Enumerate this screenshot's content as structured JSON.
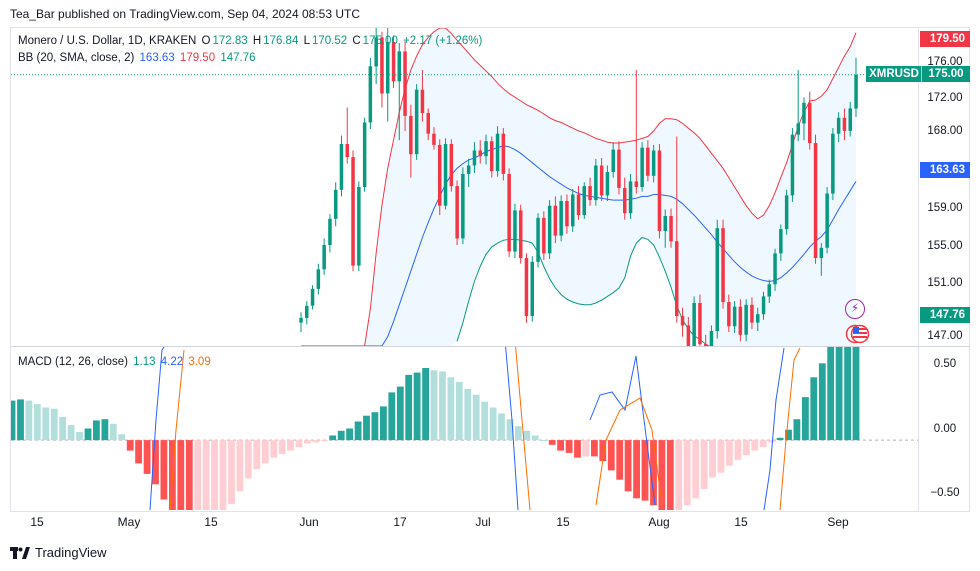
{
  "header": {
    "published": "Tea_Bar published on TradingView.com, Sep 04, 2024 08:53 UTC"
  },
  "legend": {
    "symbol": "Monero / U.S. Dollar, 1D, KRAKEN",
    "o_label": "O",
    "o": "172.83",
    "h_label": "H",
    "h": "176.84",
    "l_label": "L",
    "l": "170.52",
    "c_label": "C",
    "c": "175.00",
    "change": "+2.17 (+1.26%)",
    "bb_label": "BB (20, SMA, close, 2)",
    "bb_basis": "163.63",
    "bb_upper": "179.50",
    "bb_lower": "147.76",
    "macd_label": "MACD (12, 26, close)",
    "macd_hist": "1.13",
    "macd_line": "4.22",
    "macd_signal": "3.09"
  },
  "tags": {
    "upper": "179.50",
    "symbol": "XMRUSD",
    "price": "175.00",
    "basis": "163.63",
    "lower": "147.76"
  },
  "price_axis": [
    "176.00",
    "172.00",
    "168.00",
    "163.63",
    "159.00",
    "155.00",
    "151.00",
    "147.00"
  ],
  "macd_axis": [
    "0.50",
    "0.00",
    "−0.50"
  ],
  "time_axis": [
    "15",
    "May",
    "15",
    "Jun",
    "17",
    "Jul",
    "15",
    "Aug",
    "15",
    "Sep"
  ],
  "footer": {
    "brand": "TradingView"
  },
  "colors": {
    "up": "#089981",
    "down": "#f23645",
    "basis": "#2962ff",
    "upper": "#f23645",
    "lower": "#089981",
    "hist_up_strong": "#26a69a",
    "hist_up_weak": "#b2dfdb",
    "hist_down_strong": "#ff5252",
    "hist_down_weak": "#ffcdd2"
  },
  "chart_data": {
    "type": "candlestick",
    "symbol": "XMRUSD",
    "interval": "1D",
    "price_range_visible": [
      146,
      180
    ],
    "last_close": 175.0,
    "bollinger": {
      "length": 20,
      "basis": 163.63,
      "upper": 179.5,
      "lower": 147.76
    },
    "macd": {
      "fast": 12,
      "slow": 26,
      "histogram": 1.13,
      "macd": 4.22,
      "signal": 3.09
    },
    "macd_range_visible": [
      -0.6,
      0.8
    ],
    "candles": [
      [
        148.5,
        149.6,
        147.5,
        149.0
      ],
      [
        149.0,
        150.8,
        148.3,
        150.3
      ],
      [
        150.3,
        152.5,
        149.9,
        152.1
      ],
      [
        152.1,
        154.8,
        151.5,
        154.2
      ],
      [
        154.2,
        157.5,
        153.6,
        156.8
      ],
      [
        156.8,
        160.1,
        156.0,
        159.6
      ],
      [
        159.6,
        163.5,
        158.8,
        162.7
      ],
      [
        162.7,
        168.5,
        162.0,
        167.6
      ],
      [
        167.6,
        171.5,
        165.5,
        166.2
      ],
      [
        166.2,
        166.9,
        154.0,
        154.6
      ],
      [
        154.6,
        163.6,
        154.0,
        163.0
      ],
      [
        163.0,
        170.4,
        162.5,
        169.9
      ],
      [
        169.9,
        176.8,
        169.2,
        175.9
      ],
      [
        175.9,
        180.2,
        174.0,
        179.0
      ],
      [
        179.0,
        179.6,
        171.5,
        173.0
      ],
      [
        173.0,
        180.3,
        170.0,
        178.5
      ],
      [
        178.5,
        179.2,
        173.6,
        174.3
      ],
      [
        174.3,
        178.4,
        168.0,
        177.5
      ],
      [
        177.5,
        178.6,
        169.0,
        170.6
      ],
      [
        170.6,
        171.8,
        164.0,
        166.5
      ],
      [
        166.5,
        174.0,
        165.9,
        173.4
      ],
      [
        173.4,
        175.5,
        170.0,
        170.9
      ],
      [
        170.9,
        171.4,
        168.0,
        168.7
      ],
      [
        168.7,
        169.4,
        167.0,
        167.5
      ],
      [
        167.5,
        168.1,
        160.0,
        161.0
      ],
      [
        161.0,
        168.2,
        160.6,
        167.6
      ],
      [
        167.6,
        168.1,
        162.5,
        163.1
      ],
      [
        163.1,
        163.7,
        156.8,
        157.5
      ],
      [
        157.5,
        165.1,
        156.9,
        164.4
      ],
      [
        164.4,
        166.0,
        163.0,
        165.3
      ],
      [
        165.3,
        167.8,
        164.5,
        166.9
      ],
      [
        166.9,
        168.0,
        165.5,
        166.3
      ],
      [
        166.3,
        168.6,
        165.4,
        167.9
      ],
      [
        167.9,
        168.4,
        164.0,
        164.7
      ],
      [
        164.7,
        169.5,
        164.1,
        168.7
      ],
      [
        168.7,
        169.3,
        163.7,
        164.4
      ],
      [
        164.4,
        165.0,
        155.5,
        156.1
      ],
      [
        156.1,
        161.2,
        155.4,
        160.5
      ],
      [
        160.5,
        161.1,
        154.8,
        155.4
      ],
      [
        155.4,
        155.9,
        148.5,
        149.2
      ],
      [
        149.2,
        155.6,
        148.6,
        155.0
      ],
      [
        155.0,
        160.2,
        154.4,
        159.7
      ],
      [
        159.7,
        160.4,
        155.2,
        155.9
      ],
      [
        155.9,
        161.6,
        155.3,
        161.0
      ],
      [
        161.0,
        162.0,
        157.0,
        157.8
      ],
      [
        157.8,
        162.1,
        157.2,
        161.5
      ],
      [
        161.5,
        162.2,
        158.0,
        158.8
      ],
      [
        158.8,
        162.8,
        158.2,
        162.2
      ],
      [
        162.2,
        163.1,
        159.5,
        160.0
      ],
      [
        160.0,
        163.5,
        159.6,
        163.1
      ],
      [
        163.1,
        164.0,
        161.0,
        161.6
      ],
      [
        161.6,
        166.0,
        161.0,
        165.3
      ],
      [
        165.3,
        166.1,
        161.5,
        162.1
      ],
      [
        162.1,
        165.3,
        161.5,
        164.6
      ],
      [
        164.6,
        167.8,
        164.0,
        167.0
      ],
      [
        167.0,
        167.9,
        162.2,
        162.9
      ],
      [
        162.9,
        164.0,
        159.5,
        160.2
      ],
      [
        160.2,
        164.4,
        159.6,
        163.6
      ],
      [
        163.6,
        175.5,
        162.3,
        163.0
      ],
      [
        163.0,
        167.8,
        162.5,
        167.2
      ],
      [
        167.2,
        168.0,
        163.6,
        164.2
      ],
      [
        164.2,
        167.5,
        163.5,
        166.9
      ],
      [
        166.9,
        167.6,
        157.5,
        158.3
      ],
      [
        158.3,
        160.6,
        156.5,
        159.9
      ],
      [
        159.9,
        160.7,
        156.5,
        157.2
      ],
      [
        157.2,
        168.4,
        148.5,
        149.2
      ],
      [
        149.2,
        150.1,
        147.0,
        148.2
      ],
      [
        148.2,
        149.1,
        145.0,
        146.0
      ],
      [
        146.0,
        151.3,
        145.5,
        150.6
      ],
      [
        150.6,
        151.5,
        145.5,
        146.2
      ],
      [
        146.2,
        147.2,
        144.5,
        145.6
      ],
      [
        145.6,
        148.2,
        145.0,
        147.6
      ],
      [
        147.6,
        159.5,
        146.8,
        158.6
      ],
      [
        158.6,
        159.5,
        150.0,
        150.7
      ],
      [
        150.7,
        151.5,
        147.5,
        148.1
      ],
      [
        148.1,
        150.8,
        147.4,
        150.2
      ],
      [
        150.2,
        151.0,
        146.5,
        147.2
      ],
      [
        147.2,
        151.0,
        146.5,
        150.4
      ],
      [
        150.4,
        151.2,
        147.8,
        148.5
      ],
      [
        148.5,
        150.1,
        147.6,
        149.4
      ],
      [
        149.4,
        151.8,
        148.8,
        151.3
      ],
      [
        151.3,
        153.1,
        150.6,
        152.6
      ],
      [
        152.6,
        156.4,
        151.9,
        155.9
      ],
      [
        155.9,
        159.0,
        155.1,
        158.5
      ],
      [
        158.5,
        162.7,
        157.9,
        162.1
      ],
      [
        162.1,
        169.3,
        161.4,
        168.6
      ],
      [
        168.6,
        175.5,
        167.9,
        169.8
      ],
      [
        169.8,
        172.6,
        168.0,
        172.0
      ],
      [
        172.0,
        173.2,
        167.0,
        167.7
      ],
      [
        167.7,
        168.6,
        154.8,
        155.4
      ],
      [
        155.4,
        157.0,
        153.5,
        156.5
      ],
      [
        156.5,
        163.0,
        155.9,
        162.3
      ],
      [
        162.3,
        169.3,
        161.6,
        168.7
      ],
      [
        168.7,
        171.0,
        167.8,
        170.4
      ],
      [
        170.4,
        171.4,
        168.0,
        169.0
      ],
      [
        169.0,
        172.1,
        168.4,
        171.4
      ],
      [
        171.4,
        176.8,
        170.5,
        175.0
      ]
    ],
    "bb_upper": [
      146.0,
      146.0,
      146.0,
      146.0,
      146.0,
      146.0,
      146.0,
      146.0,
      146.0,
      146.0,
      146.0,
      146.0,
      150.0,
      156.0,
      161.0,
      165.0,
      168.0,
      171.0,
      173.5,
      175.5,
      177.0,
      178.2,
      179.0,
      179.6,
      180.0,
      180.0,
      179.4,
      178.7,
      178.0,
      177.3,
      176.6,
      176.0,
      175.4,
      174.8,
      174.1,
      173.5,
      173.0,
      172.6,
      172.2,
      171.8,
      171.5,
      171.2,
      170.8,
      170.4,
      170.1,
      169.9,
      169.6,
      169.3,
      169.0,
      168.8,
      168.5,
      168.2,
      168.0,
      167.8,
      167.7,
      167.7,
      167.8,
      167.9,
      168.0,
      168.2,
      168.4,
      169.0,
      169.8,
      170.3,
      170.3,
      170.2,
      169.8,
      169.3,
      168.8,
      168.2,
      167.4,
      166.6,
      165.8,
      165.0,
      164.0,
      163.0,
      162.0,
      161.0,
      160.2,
      159.6,
      160.0,
      161.0,
      162.4,
      164.0,
      165.6,
      167.5,
      169.5,
      171.0,
      172.2,
      172.3,
      172.7,
      173.4,
      174.6,
      175.8,
      177.0,
      178.0,
      179.5
    ],
    "bb_basis": [
      146.0,
      146.0,
      146.0,
      146.0,
      146.0,
      146.0,
      146.0,
      146.0,
      146.0,
      146.0,
      146.0,
      146.0,
      146.0,
      146.0,
      146.0,
      147.0,
      148.6,
      150.4,
      152.2,
      154.0,
      155.8,
      157.6,
      159.2,
      160.7,
      162.0,
      163.3,
      164.3,
      165.0,
      165.5,
      165.9,
      166.1,
      166.4,
      166.8,
      167.0,
      167.2,
      167.4,
      167.3,
      167.0,
      166.6,
      166.1,
      165.6,
      165.1,
      164.6,
      164.1,
      163.7,
      163.3,
      162.9,
      162.6,
      162.3,
      162.1,
      162.0,
      161.9,
      161.8,
      161.7,
      161.6,
      161.6,
      161.6,
      161.7,
      161.8,
      162.0,
      162.0,
      162.2,
      162.2,
      162.1,
      162.0,
      161.7,
      161.2,
      160.6,
      160.0,
      159.3,
      158.6,
      157.9,
      157.1,
      156.4,
      155.7,
      155.0,
      154.4,
      153.9,
      153.5,
      153.2,
      153.0,
      152.9,
      153.0,
      153.3,
      153.8,
      154.4,
      155.1,
      155.8,
      156.6,
      157.2,
      157.7,
      158.4,
      159.5,
      160.6,
      161.6,
      162.6,
      163.6
    ],
    "bb_lower": [
      null,
      null,
      null,
      null,
      null,
      null,
      null,
      null,
      null,
      null,
      null,
      null,
      null,
      null,
      null,
      null,
      null,
      null,
      null,
      null,
      null,
      null,
      null,
      null,
      null,
      null,
      null,
      146.5,
      148.5,
      150.8,
      152.9,
      154.5,
      155.8,
      156.6,
      157.0,
      157.3,
      157.4,
      157.4,
      157.3,
      157.2,
      157.0,
      156.0,
      154.5,
      153.2,
      152.2,
      151.5,
      151.0,
      150.7,
      150.5,
      150.4,
      150.4,
      150.6,
      150.9,
      151.3,
      151.7,
      152.2,
      153.3,
      155.6,
      157.0,
      157.6,
      157.4,
      156.8,
      155.5,
      154.0,
      152.3,
      150.3,
      148.8,
      147.8,
      147.1,
      146.7,
      146.2,
      145.8,
      145.5,
      null,
      null,
      null,
      null,
      null,
      null,
      null,
      null,
      null,
      null,
      null,
      null,
      null,
      null,
      null,
      null,
      null,
      null,
      null,
      null,
      null,
      null,
      null,
      null
    ],
    "macd_histogram": [
      0.34,
      0.35,
      0.34,
      0.31,
      0.28,
      0.27,
      0.2,
      0.13,
      0.07,
      0.1,
      0.17,
      0.18,
      0.14,
      0.05,
      -0.09,
      -0.2,
      -0.29,
      -0.38,
      -0.51,
      -0.65,
      -0.85,
      -0.86,
      -0.82,
      -0.73,
      -0.71,
      -0.62,
      -0.55,
      -0.44,
      -0.33,
      -0.25,
      -0.2,
      -0.15,
      -0.12,
      -0.09,
      -0.06,
      -0.03,
      -0.02,
      -0.01,
      0.04,
      0.08,
      0.1,
      0.16,
      0.21,
      0.24,
      0.29,
      0.41,
      0.46,
      0.56,
      0.58,
      0.62,
      0.6,
      0.59,
      0.54,
      0.5,
      0.44,
      0.39,
      0.33,
      0.28,
      0.23,
      0.18,
      0.12,
      0.08,
      0.04,
      0.0,
      -0.04,
      -0.09,
      -0.11,
      -0.15,
      -0.14,
      -0.14,
      -0.18,
      -0.26,
      -0.34,
      -0.44,
      -0.5,
      -0.52,
      -0.56,
      -0.72,
      -0.72,
      -0.64,
      -0.56,
      -0.5,
      -0.42,
      -0.32,
      -0.28,
      -0.22,
      -0.17,
      -0.13,
      -0.09,
      -0.06,
      -0.02,
      0.02,
      0.09,
      0.18,
      0.37,
      0.54,
      0.66,
      0.81,
      0.92,
      1.05,
      1.13
    ]
  }
}
